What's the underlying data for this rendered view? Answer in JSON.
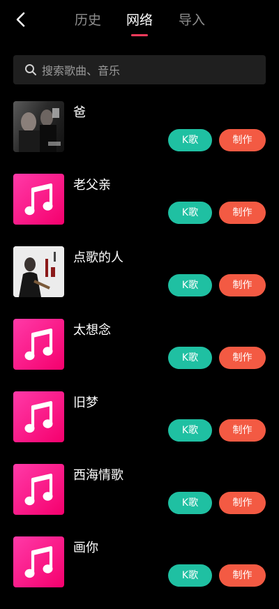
{
  "header": {
    "tabs": [
      {
        "label": "历史",
        "active": false
      },
      {
        "label": "网络",
        "active": true
      },
      {
        "label": "导入",
        "active": false
      }
    ],
    "active_underline_color": "#ff3b5c"
  },
  "search": {
    "placeholder": "搜索歌曲、音乐"
  },
  "songs": [
    {
      "title": "爸",
      "cover": "album-photo",
      "k_label": "K歌",
      "make_label": "制作"
    },
    {
      "title": "老父亲",
      "cover": "music-note-icon",
      "k_label": "K歌",
      "make_label": "制作"
    },
    {
      "title": "点歌的人",
      "cover": "album-photo",
      "k_label": "K歌",
      "make_label": "制作"
    },
    {
      "title": "太想念",
      "cover": "music-note-icon",
      "k_label": "K歌",
      "make_label": "制作"
    },
    {
      "title": "旧梦",
      "cover": "music-note-icon",
      "k_label": "K歌",
      "make_label": "制作"
    },
    {
      "title": "西海情歌",
      "cover": "music-note-icon",
      "k_label": "K歌",
      "make_label": "制作"
    },
    {
      "title": "画你",
      "cover": "music-note-icon",
      "k_label": "K歌",
      "make_label": "制作"
    }
  ],
  "colors": {
    "background": "#000000",
    "k_button": "#1fc0a2",
    "make_button": "#f35a43",
    "note_cover": "#f5006d"
  }
}
